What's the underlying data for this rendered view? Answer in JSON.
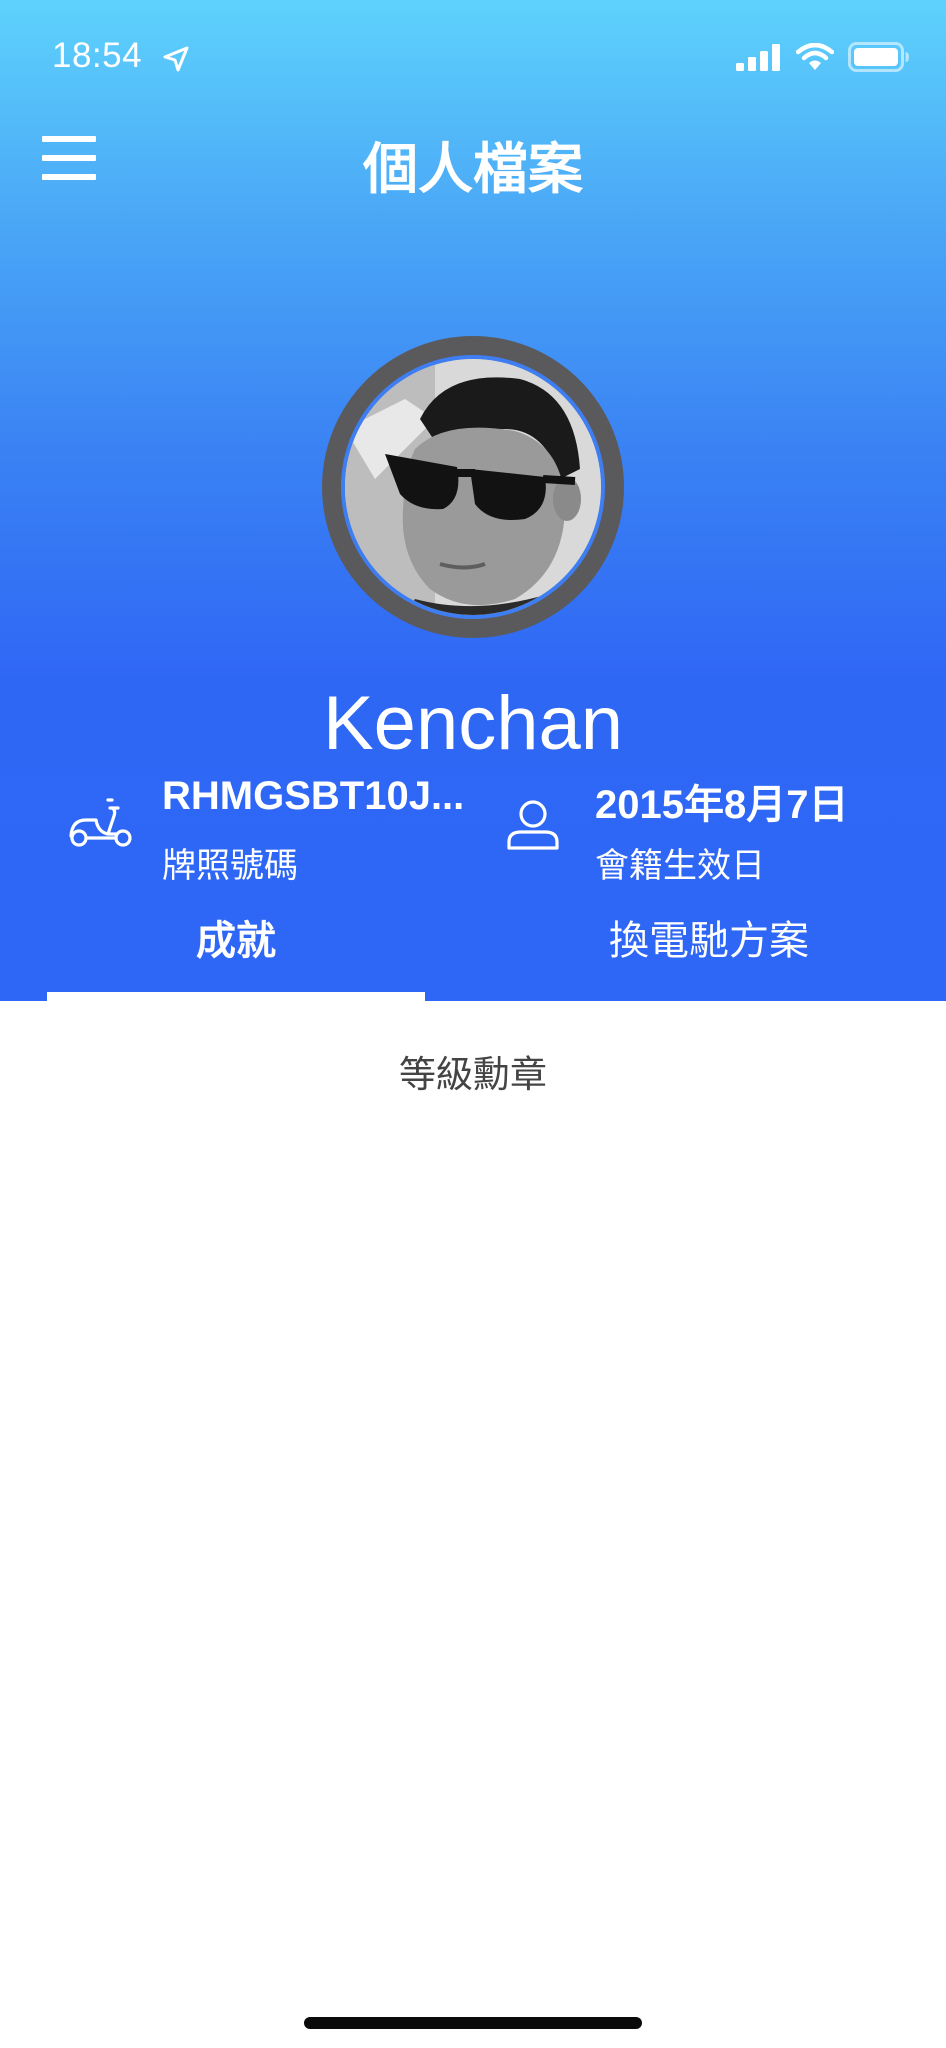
{
  "status_bar": {
    "time": "18:54",
    "icons": [
      "location-arrow-icon",
      "cellular-signal-icon",
      "wifi-icon",
      "battery-icon"
    ]
  },
  "nav": {
    "title": "個人檔案",
    "menu_icon": "hamburger-menu-icon"
  },
  "profile": {
    "avatar_icon": "user-photo",
    "name": "Kenchan"
  },
  "info": {
    "plate": {
      "icon": "scooter-icon",
      "value": "RHMGSBT10J...",
      "label": "牌照號碼"
    },
    "membership": {
      "icon": "person-icon",
      "value": "2015年8月7日",
      "label": "會籍生效日"
    }
  },
  "tabs": [
    {
      "label": "成就",
      "active": true
    },
    {
      "label": "換電馳方案",
      "active": false
    }
  ],
  "content": {
    "section_title": "等級勳章"
  },
  "colors": {
    "gradient_top": "#5ed2fc",
    "gradient_bottom": "#2e66f6",
    "avatar_ring": "#5a5a5d",
    "avatar_accent": "#3e7ef2"
  }
}
